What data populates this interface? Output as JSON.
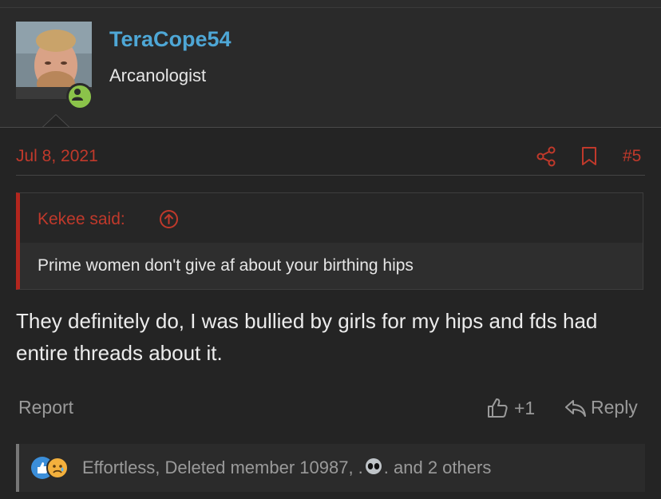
{
  "user": {
    "name": "TeraCope54",
    "title": "Arcanologist",
    "status_color": "#8bc34a"
  },
  "post": {
    "date": "Jul 8, 2021",
    "number": "#5",
    "quote": {
      "author": "Kekee said:",
      "text": "Prime women don't give af about your birthing hips"
    },
    "message": "They definitely do, I was bullied by girls for my hips and fds had entire threads about it."
  },
  "actions": {
    "report_label": "Report",
    "like_count": "+1",
    "reply_label": "Reply"
  },
  "reactions": {
    "prefix": "Effortless, Deleted member 10987, .",
    "suffix": ". and 2 others",
    "icons": [
      "like-reaction-icon",
      "sad-reaction-icon",
      "alien-emoji-icon"
    ]
  },
  "colors": {
    "accent_red": "#c0392b",
    "username_blue": "#4ea7d6",
    "background": "#242424"
  }
}
